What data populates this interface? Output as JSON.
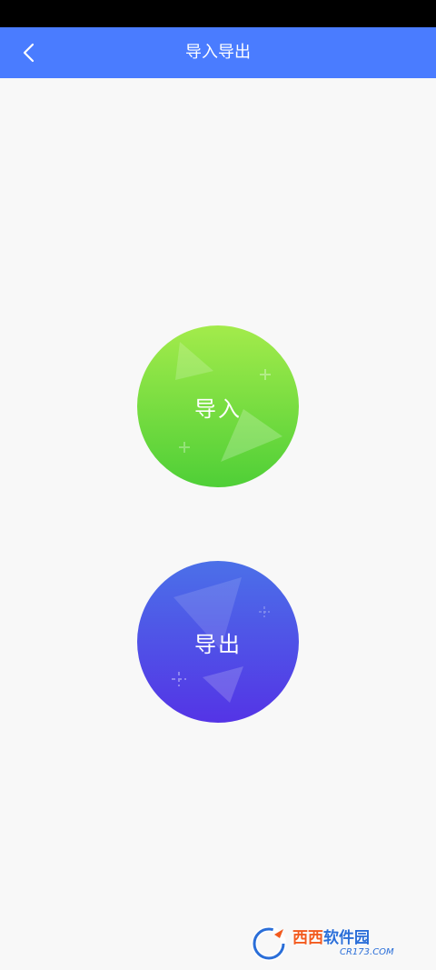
{
  "nav": {
    "title": "导入导出",
    "back_icon": "chevron-left-icon"
  },
  "actions": {
    "import_label": "导入",
    "export_label": "导出"
  },
  "watermark": {
    "brand_a": "西西",
    "brand_b": "软件园",
    "domain": "CR173.COM"
  },
  "colors": {
    "nav_bg": "#4a7cff",
    "import_gradient": [
      "#a3eb4b",
      "#4fcf37"
    ],
    "export_gradient": [
      "#4b70e8",
      "#5434e6"
    ],
    "page_bg": "#f8f8f8"
  }
}
